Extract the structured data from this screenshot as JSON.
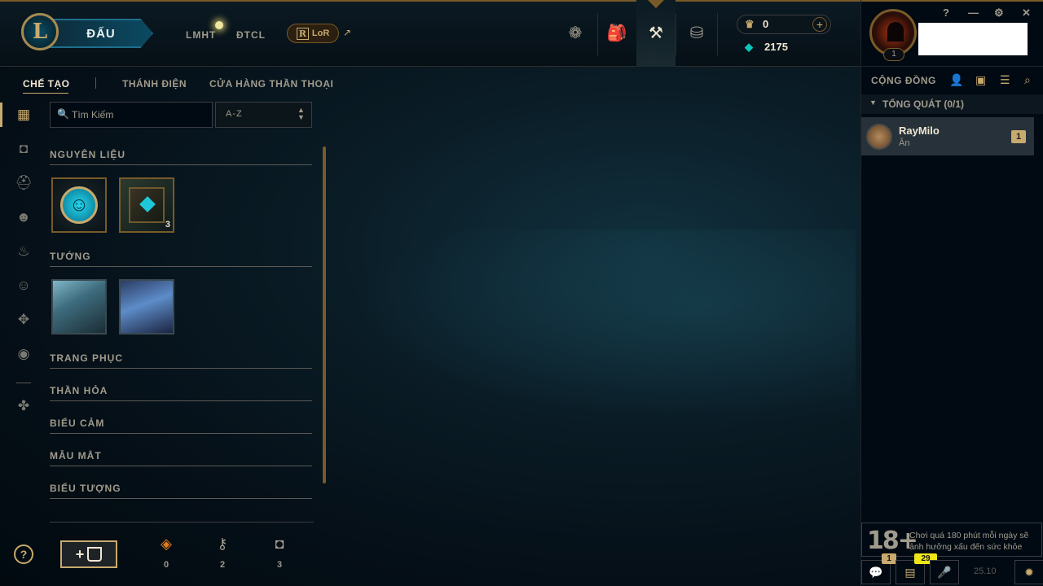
{
  "topnav": {
    "play_label": "ĐẤU",
    "links": [
      "LMHT",
      "ĐTCL"
    ],
    "lor_label": "LoR",
    "currency": {
      "rp": "0",
      "be": "2175"
    }
  },
  "window_controls": [
    "?",
    "—",
    "⚙",
    "✕"
  ],
  "profile": {
    "level": "1"
  },
  "social": {
    "title": "CỘNG ĐỒNG",
    "group_title": "TỔNG QUÁT (0/1)",
    "friend": {
      "name": "RayMilo",
      "status": "Ăn",
      "badge": "1"
    },
    "warning_18": "18+",
    "warning_text": "Chơi quá 180 phút mỗi ngày sẽ ảnh hưởng xấu đến sức khỏe",
    "chat_badge": "1",
    "notif_badge": "29",
    "version": "25.10"
  },
  "collection_tabs": [
    "CHẾ TẠO",
    "THÁNH ĐIỆN",
    "CỬA HÀNG THẦN THOẠI"
  ],
  "search": {
    "placeholder": "Tìm Kiếm"
  },
  "sort": {
    "value": "A-Z"
  },
  "categories": {
    "materials": "NGUYÊN LIỆU",
    "champions": "TƯỚNG",
    "skins": "TRANG PHỤC",
    "wards": "THẦN HỎA",
    "emotes": "BIỂU CẢM",
    "eyes": "MẪU MẮT",
    "icons": "BIỂU TƯỢNG"
  },
  "materials_items": [
    {
      "name": "emote-token",
      "count": ""
    },
    {
      "name": "hextech-chest",
      "count": "3"
    }
  ],
  "resources": {
    "essence": "0",
    "keys": "2",
    "chests": "3"
  },
  "colors": {
    "gold": "#c8aa6e",
    "dark_gold": "#785a28",
    "blue": "#0ac8b9"
  }
}
